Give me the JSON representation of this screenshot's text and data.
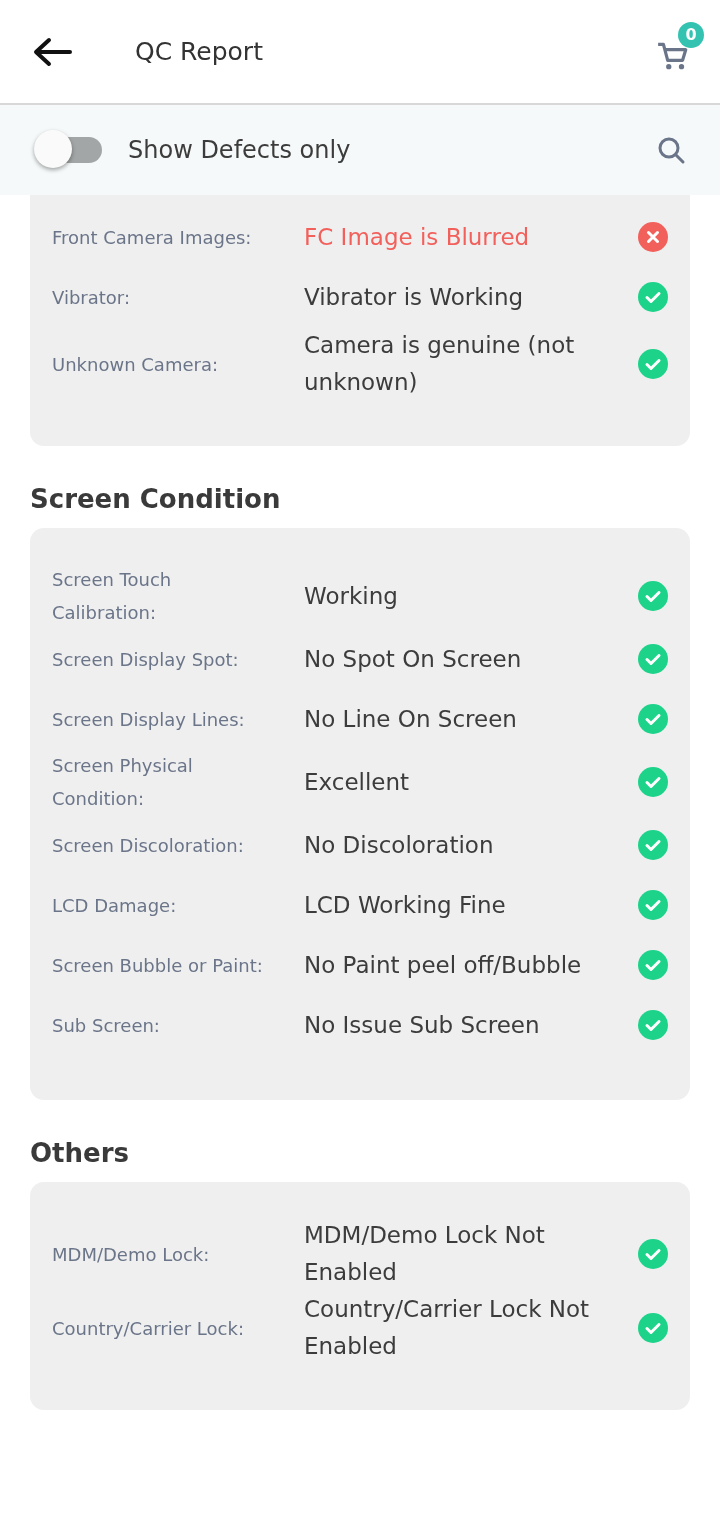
{
  "header": {
    "title": "QC Report",
    "cart_count": "0"
  },
  "filter": {
    "label": "Show Defects only",
    "on": false
  },
  "sections": [
    {
      "items": [
        {
          "label": "Front Camera Images:",
          "value": "FC Image is Blurred",
          "passed": false
        },
        {
          "label": "Vibrator:",
          "value": "Vibrator is Working",
          "passed": true
        },
        {
          "label": "Unknown Camera:",
          "value": "Camera is genuine (not unknown)",
          "passed": true
        }
      ]
    },
    {
      "title": "Screen Condition",
      "items": [
        {
          "label": "Screen Touch Calibration:",
          "value": "Working",
          "passed": true
        },
        {
          "label": "Screen Display Spot:",
          "value": "No Spot On Screen",
          "passed": true
        },
        {
          "label": "Screen Display Lines:",
          "value": "No Line On Screen",
          "passed": true
        },
        {
          "label": "Screen Physical Condition:",
          "value": "Excellent",
          "passed": true
        },
        {
          "label": "Screen Discoloration:",
          "value": "No Discoloration",
          "passed": true
        },
        {
          "label": "LCD Damage:",
          "value": "LCD Working Fine",
          "passed": true
        },
        {
          "label": "Screen Bubble or Paint:",
          "value": "No Paint peel off/Bubble",
          "passed": true
        },
        {
          "label": "Sub Screen:",
          "value": "No Issue Sub Screen",
          "passed": true
        }
      ]
    },
    {
      "title": "Others",
      "items": [
        {
          "label": "MDM/Demo Lock:",
          "value": "MDM/Demo Lock Not Enabled",
          "passed": true
        },
        {
          "label": "Country/Carrier Lock:",
          "value": "Country/Carrier Lock Not Enabled",
          "passed": true
        }
      ]
    }
  ]
}
